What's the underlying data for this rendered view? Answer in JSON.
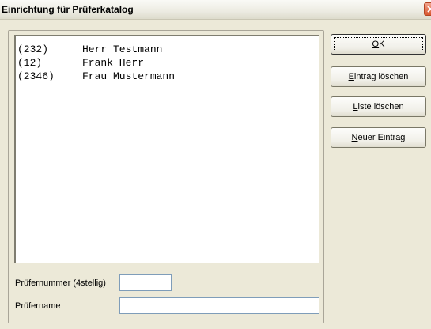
{
  "window": {
    "title": "Einrichtung für Prüferkatalog"
  },
  "list": {
    "items": [
      {
        "number": "(232)",
        "name": "Herr Testmann"
      },
      {
        "number": "(12)",
        "name": "Frank Herr"
      },
      {
        "number": "(2346)",
        "name": "Frau Mustermann"
      }
    ]
  },
  "form": {
    "number_label": "Prüfernummer (4stellig)",
    "number_value": "",
    "name_label": "Prüfername",
    "name_value": ""
  },
  "buttons": {
    "ok": {
      "mnemonic": "O",
      "rest": "K"
    },
    "delete_entry": {
      "mnemonic": "E",
      "rest": "intrag löschen"
    },
    "clear_list": {
      "mnemonic": "L",
      "rest": "iste löschen"
    },
    "new_entry": {
      "mnemonic": "N",
      "rest": "euer Eintrag"
    }
  },
  "icons": {
    "close": "close-icon"
  },
  "colors": {
    "dialog_background": "#ece9d8",
    "close_button": "#d8572f",
    "input_border": "#7f9db9"
  }
}
